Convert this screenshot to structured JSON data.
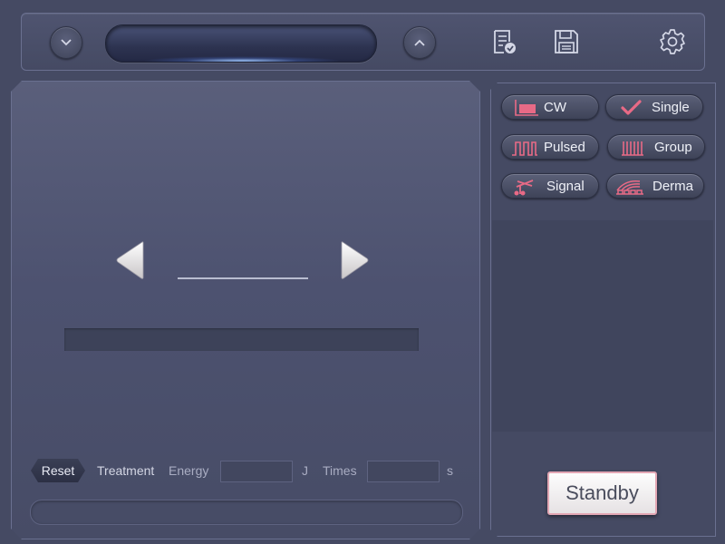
{
  "header": {
    "title": "",
    "buttons": {
      "collapse_icon": "chevron-down-icon",
      "expand_icon": "chevron-up-icon",
      "report_icon": "report-icon",
      "save_icon": "save-icon",
      "settings_icon": "gear-icon"
    }
  },
  "main": {
    "value": "",
    "reset_label": "Reset",
    "treatment_label": "Treatment",
    "energy": {
      "label": "Energy",
      "value": "",
      "unit": "J"
    },
    "times": {
      "label": "Times",
      "value": "",
      "unit": "s"
    }
  },
  "modes": [
    {
      "label": "CW",
      "icon": "cw-wave-icon"
    },
    {
      "label": "Single",
      "icon": "checkmark-icon"
    },
    {
      "label": "Pulsed",
      "icon": "pulsed-wave-icon"
    },
    {
      "label": "Group",
      "icon": "group-pulse-icon"
    },
    {
      "label": "Signal",
      "icon": "signal-icon"
    },
    {
      "label": "Derma",
      "icon": "derma-icon"
    }
  ],
  "standby_label": "Standby",
  "colors": {
    "accent": "#e86a86",
    "background": "#454a63",
    "standby_border": "#e3a7b4"
  }
}
